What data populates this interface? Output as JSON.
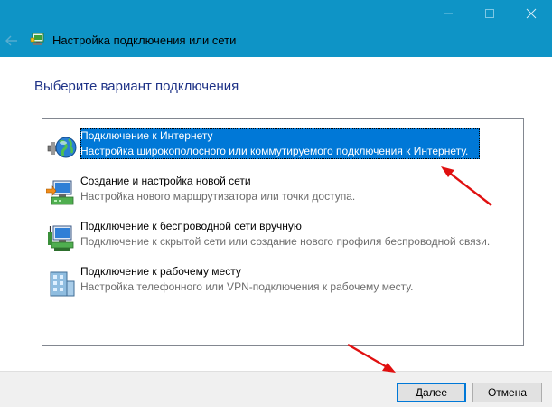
{
  "window": {
    "title": "Настройка подключения или сети",
    "controls": {
      "minimize": "minimize-icon",
      "maximize": "maximize-icon",
      "close": "close-icon"
    },
    "accent_color": "#0e94c6"
  },
  "heading": "Выберите вариант подключения",
  "options": [
    {
      "title": "Подключение к Интернету",
      "description": "Настройка широкополосного или коммутируемого подключения к Интернету.",
      "icon": "globe-network-icon",
      "selected": true
    },
    {
      "title": "Создание и настройка новой сети",
      "description": "Настройка нового маршрутизатора или точки доступа.",
      "icon": "router-setup-icon",
      "selected": false
    },
    {
      "title": "Подключение к беспроводной сети вручную",
      "description": "Подключение к скрытой сети или создание нового профиля беспроводной связи.",
      "icon": "wireless-network-icon",
      "selected": false
    },
    {
      "title": "Подключение к рабочему месту",
      "description": "Настройка телефонного или VPN-подключения к рабочему месту.",
      "icon": "workplace-building-icon",
      "selected": false
    }
  ],
  "buttons": {
    "next": "Далее",
    "cancel": "Отмена"
  },
  "annotation_color": "#e01010"
}
